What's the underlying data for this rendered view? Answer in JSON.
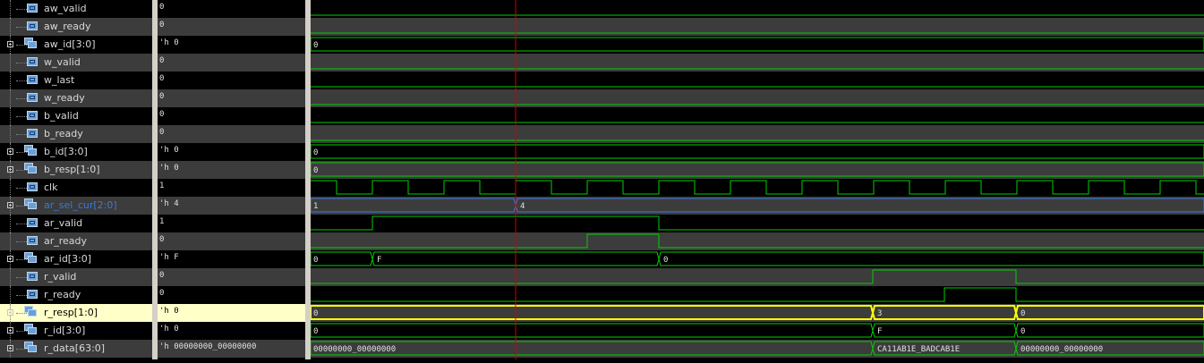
{
  "signals": [
    {
      "name": "aw_valid",
      "value": "0",
      "bus": false
    },
    {
      "name": "aw_ready",
      "value": "0",
      "bus": false
    },
    {
      "name": "aw_id[3:0]",
      "value": "'h 0",
      "bus": true
    },
    {
      "name": "w_valid",
      "value": "0",
      "bus": false
    },
    {
      "name": "w_last",
      "value": "0",
      "bus": false
    },
    {
      "name": "w_ready",
      "value": "0",
      "bus": false
    },
    {
      "name": "b_valid",
      "value": "0",
      "bus": false
    },
    {
      "name": "b_ready",
      "value": "0",
      "bus": false
    },
    {
      "name": "b_id[3:0]",
      "value": "'h 0",
      "bus": true
    },
    {
      "name": "b_resp[1:0]",
      "value": "'h 0",
      "bus": true
    },
    {
      "name": "clk",
      "value": "1",
      "bus": false
    },
    {
      "name": "ar_sel_cur[2:0]",
      "value": "'h 4",
      "bus": true,
      "highlight_name": true
    },
    {
      "name": "ar_valid",
      "value": "1",
      "bus": false
    },
    {
      "name": "ar_ready",
      "value": "0",
      "bus": false
    },
    {
      "name": "ar_id[3:0]",
      "value": "'h F",
      "bus": true
    },
    {
      "name": "r_valid",
      "value": "0",
      "bus": false
    },
    {
      "name": "r_ready",
      "value": "0",
      "bus": false
    },
    {
      "name": "r_resp[1:0]",
      "value": "'h 0",
      "bus": true,
      "selected": true
    },
    {
      "name": "r_id[3:0]",
      "value": "'h 0",
      "bus": true
    },
    {
      "name": "r_data[63:0]",
      "value": "'h 00000000_00000000",
      "bus": true
    }
  ],
  "colors": {
    "wave": "#00d000",
    "blue": "#3a7ad8",
    "yellow": "#ffff00",
    "cursor": "#d00000",
    "select_bg": "#ffffc8"
  },
  "cursor_time": 229,
  "waves": {
    "aw_valid": {
      "type": "bit",
      "segments": [
        [
          0,
          998,
          0
        ]
      ]
    },
    "aw_ready": {
      "type": "bit",
      "segments": [
        [
          0,
          998,
          0
        ]
      ]
    },
    "w_valid": {
      "type": "bit",
      "segments": [
        [
          0,
          998,
          0
        ]
      ]
    },
    "w_last": {
      "type": "bit",
      "segments": [
        [
          0,
          998,
          0
        ]
      ]
    },
    "w_ready": {
      "type": "bit",
      "segments": [
        [
          0,
          998,
          0
        ]
      ]
    },
    "b_valid": {
      "type": "bit",
      "segments": [
        [
          0,
          998,
          0
        ]
      ]
    },
    "b_ready": {
      "type": "bit",
      "segments": [
        [
          0,
          998,
          0
        ]
      ]
    },
    "ar_valid": {
      "type": "bit",
      "segments": [
        [
          0,
          69,
          0
        ],
        [
          69,
          389,
          1
        ],
        [
          389,
          998,
          0
        ]
      ]
    },
    "ar_ready": {
      "type": "bit",
      "segments": [
        [
          0,
          309,
          0
        ],
        [
          309,
          389,
          1
        ],
        [
          389,
          998,
          0
        ]
      ]
    },
    "r_valid": {
      "type": "bit",
      "segments": [
        [
          0,
          628,
          0
        ],
        [
          628,
          788,
          1
        ],
        [
          788,
          998,
          0
        ]
      ]
    },
    "r_ready": {
      "type": "bit",
      "segments": [
        [
          0,
          708,
          0
        ],
        [
          708,
          788,
          1
        ],
        [
          788,
          998,
          0
        ]
      ]
    },
    "clk": {
      "type": "clock",
      "period": 80,
      "high_first_end": 29
    },
    "aw_id[3:0]": {
      "type": "bus",
      "segments": [
        [
          0,
          998,
          "0"
        ]
      ]
    },
    "b_id[3:0]": {
      "type": "bus",
      "segments": [
        [
          0,
          998,
          "0"
        ]
      ]
    },
    "b_resp[1:0]": {
      "type": "bus",
      "segments": [
        [
          0,
          998,
          "0"
        ]
      ]
    },
    "ar_sel_cur[2:0]": {
      "type": "bus",
      "color": "blue",
      "segments": [
        [
          0,
          229,
          "1"
        ],
        [
          229,
          998,
          "4"
        ]
      ]
    },
    "ar_id[3:0]": {
      "type": "bus",
      "segments": [
        [
          0,
          69,
          "0"
        ],
        [
          69,
          389,
          "F"
        ],
        [
          389,
          998,
          "0"
        ]
      ]
    },
    "r_resp[1:0]": {
      "type": "bus",
      "color": "yellow",
      "segments": [
        [
          0,
          628,
          "0"
        ],
        [
          628,
          788,
          "3"
        ],
        [
          788,
          998,
          "0"
        ]
      ]
    },
    "r_id[3:0]": {
      "type": "bus",
      "segments": [
        [
          0,
          628,
          "0"
        ],
        [
          628,
          788,
          "F"
        ],
        [
          788,
          998,
          "0"
        ]
      ]
    },
    "r_data[63:0]": {
      "type": "bus",
      "segments": [
        [
          0,
          628,
          "00000000_00000000"
        ],
        [
          628,
          788,
          "CA11AB1E_BADCAB1E"
        ],
        [
          788,
          998,
          "00000000_00000000"
        ]
      ]
    }
  }
}
